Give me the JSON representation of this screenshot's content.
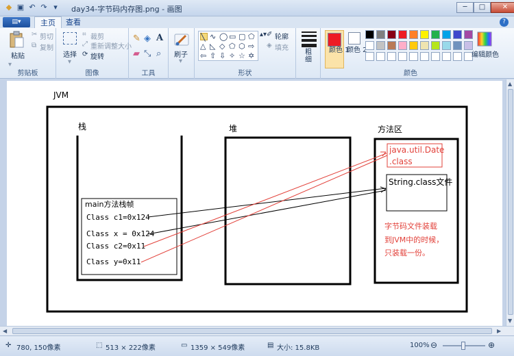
{
  "window": {
    "title": "day34-字节码内存图.png - 画图",
    "minimize_label": "─",
    "maximize_label": "□",
    "close_label": "✕"
  },
  "tabs": {
    "file_label": "▤▾",
    "home": "主页",
    "view": "查看",
    "help": "?"
  },
  "ribbon": {
    "clipboard": {
      "paste": "粘贴",
      "cut": "剪切",
      "copy": "复制",
      "label": "剪贴板"
    },
    "image": {
      "select": "选择",
      "crop": "裁剪",
      "resize": "重新调整大小",
      "rotate": "旋转",
      "label": "图像"
    },
    "tools": {
      "label": "工具"
    },
    "brushes": {
      "label": "刷子"
    },
    "shapes": {
      "outline": "轮廓",
      "fill": "填充",
      "label": "形状"
    },
    "size": {
      "label": "粗\n细"
    },
    "colors": {
      "color1": "颜色 1",
      "color2": "颜色 2",
      "edit": "编辑颜色",
      "label": "颜色",
      "color1_value": "#ed1c24",
      "color2_value": "#ffffff",
      "palette_row1": [
        "#000000",
        "#7f7f7f",
        "#880015",
        "#ed1c24",
        "#ff7f27",
        "#fff200",
        "#22b14c",
        "#00a2e8",
        "#3f48cc",
        "#a349a4"
      ],
      "palette_row2": [
        "#ffffff",
        "#c3c3c3",
        "#b97a57",
        "#ffaec9",
        "#ffc90e",
        "#efe4b0",
        "#b5e61d",
        "#99d9ea",
        "#7092be",
        "#c8bfe7"
      ],
      "palette_row3": [
        "#ffffff",
        "#ffffff",
        "#ffffff",
        "#ffffff",
        "#ffffff",
        "#ffffff",
        "#ffffff",
        "#ffffff",
        "#ffffff",
        "#ffffff"
      ]
    }
  },
  "diagram": {
    "jvm": "JVM",
    "stack": "栈",
    "heap": "堆",
    "method_area": "方法区",
    "frame_title": "main方法栈帧",
    "vars": [
      "Class c1=0x124",
      "Class x = 0x124",
      "Class c2=0x11",
      "Class y=0x11"
    ],
    "date_class_line1": "java.util.Date",
    "date_class_line2": ".class",
    "string_class": "String.class文件",
    "note": [
      "字节码文件装载",
      "到JVM中的时候，",
      "只装载一份。"
    ]
  },
  "status": {
    "cursor": "780, 150像素",
    "selection": "513 × 222像素",
    "image_size": "1359 × 549像素",
    "file_size": "大小: 15.8KB",
    "zoom": "100%"
  }
}
